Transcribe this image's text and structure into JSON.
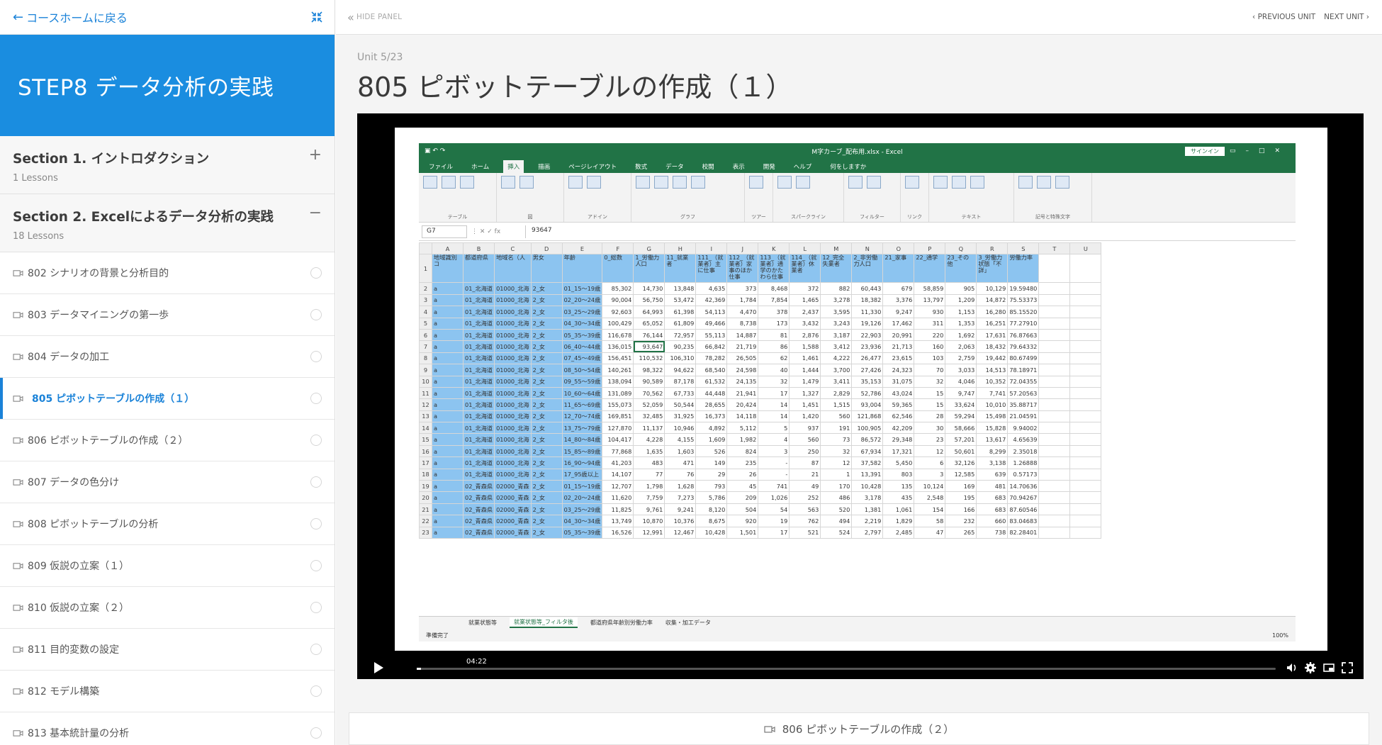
{
  "sidebar": {
    "back_label": "コースホームに戻る",
    "course_title": "STEP8 データ分析の実践",
    "sections": [
      {
        "title": "Section 1. イントロダクション",
        "count": "1 Lessons",
        "toggle": "+"
      },
      {
        "title": "Section 2. Excelによるデータ分析の実践",
        "count": "18 Lessons",
        "toggle": "−"
      }
    ],
    "lessons": [
      {
        "label": "802 シナリオの背景と分析目的"
      },
      {
        "label": "803 データマイニングの第一歩"
      },
      {
        "label": "804 データの加工"
      },
      {
        "label": "805 ピボットテーブルの作成（１）"
      },
      {
        "label": "806 ピボットテーブルの作成（２）"
      },
      {
        "label": "807 データの色分け"
      },
      {
        "label": "808 ピボットテーブルの分析"
      },
      {
        "label": "809 仮説の立案（１）"
      },
      {
        "label": "810 仮説の立案（２）"
      },
      {
        "label": "811 目的変数の設定"
      },
      {
        "label": "812 モデル構築"
      },
      {
        "label": "813 基本統計量の分析"
      }
    ],
    "active_lesson": 3
  },
  "topbar": {
    "hide_panel": "HIDE PANEL",
    "prev_unit": "PREVIOUS UNIT",
    "next_unit": "NEXT UNIT"
  },
  "unit": {
    "number": "Unit 5/23",
    "title": "805 ピボットテーブルの作成（１）"
  },
  "video": {
    "timecode": "04:22",
    "progress_fraction": 0.005
  },
  "excel": {
    "filename": "M字カーブ_配布用.xlsx - Excel",
    "signin": "サインイン",
    "tabs": [
      "ファイル",
      "ホーム",
      "挿入",
      "描画",
      "ページレイアウト",
      "数式",
      "データ",
      "校閲",
      "表示",
      "開発",
      "ヘルプ",
      "何をしますか"
    ],
    "active_tab": "挿入",
    "ribbon_groups": [
      "テーブル",
      "図",
      "アドイン",
      "グラフ",
      "ツアー",
      "スパークライン",
      "フィルター",
      "リンク",
      "テキスト",
      "記号と特殊文字"
    ],
    "name_box": "G7",
    "formula_value": "93647",
    "col_letters": [
      "A",
      "B",
      "C",
      "D",
      "E",
      "F",
      "G",
      "H",
      "I",
      "J",
      "K",
      "L",
      "M",
      "N",
      "O",
      "P",
      "Q",
      "R",
      "S",
      "T",
      "U"
    ],
    "header_row": [
      "地域識別コ",
      "都道府県",
      "地域名（人",
      "男女",
      "年齢",
      "0_総数",
      "1_労働力人口",
      "11_就業者",
      "111_（就業者）主に仕事",
      "112_（就業者）家事のほか仕事",
      "113_（就業者）通学のかたわら仕事",
      "114_（就業者）休業者",
      "12_完全失業者",
      "2_非労働力人口",
      "21_家事",
      "22_通学",
      "23_その他",
      "3_労働力状態「不詳」",
      "労働力率",
      "",
      ""
    ],
    "rows": [
      [
        "a",
        "01_北海道",
        "01000_北海",
        "2_女",
        "01_15～19歳",
        "85,302",
        "14,730",
        "13,848",
        "4,635",
        "373",
        "8,468",
        "372",
        "882",
        "60,443",
        "679",
        "58,859",
        "905",
        "10,129",
        "19.59480"
      ],
      [
        "a",
        "01_北海道",
        "01000_北海",
        "2_女",
        "02_20～24歳",
        "90,004",
        "56,750",
        "53,472",
        "42,369",
        "1,784",
        "7,854",
        "1,465",
        "3,278",
        "18,382",
        "3,376",
        "13,797",
        "1,209",
        "14,872",
        "75.53373"
      ],
      [
        "a",
        "01_北海道",
        "01000_北海",
        "2_女",
        "03_25～29歳",
        "92,603",
        "64,993",
        "61,398",
        "54,113",
        "4,470",
        "378",
        "2,437",
        "3,595",
        "11,330",
        "9,247",
        "930",
        "1,153",
        "16,280",
        "85.15520"
      ],
      [
        "a",
        "01_北海道",
        "01000_北海",
        "2_女",
        "04_30～34歳",
        "100,429",
        "65,052",
        "61,809",
        "49,466",
        "8,738",
        "173",
        "3,432",
        "3,243",
        "19,126",
        "17,462",
        "311",
        "1,353",
        "16,251",
        "77.27910"
      ],
      [
        "a",
        "01_北海道",
        "01000_北海",
        "2_女",
        "05_35～39歳",
        "116,678",
        "76,144",
        "72,957",
        "55,113",
        "14,887",
        "81",
        "2,876",
        "3,187",
        "22,903",
        "20,991",
        "220",
        "1,692",
        "17,631",
        "76.87663"
      ],
      [
        "a",
        "01_北海道",
        "01000_北海",
        "2_女",
        "06_40～44歳",
        "136,015",
        "93,647",
        "90,235",
        "66,842",
        "21,719",
        "86",
        "1,588",
        "3,412",
        "23,936",
        "21,713",
        "160",
        "2,063",
        "18,432",
        "79.64332"
      ],
      [
        "a",
        "01_北海道",
        "01000_北海",
        "2_女",
        "07_45～49歳",
        "156,451",
        "110,532",
        "106,310",
        "78,282",
        "26,505",
        "62",
        "1,461",
        "4,222",
        "26,477",
        "23,615",
        "103",
        "2,759",
        "19,442",
        "80.67499"
      ],
      [
        "a",
        "01_北海道",
        "01000_北海",
        "2_女",
        "08_50～54歳",
        "140,261",
        "98,322",
        "94,622",
        "68,540",
        "24,598",
        "40",
        "1,444",
        "3,700",
        "27,426",
        "24,323",
        "70",
        "3,033",
        "14,513",
        "78.18971"
      ],
      [
        "a",
        "01_北海道",
        "01000_北海",
        "2_女",
        "09_55～59歳",
        "138,094",
        "90,589",
        "87,178",
        "61,532",
        "24,135",
        "32",
        "1,479",
        "3,411",
        "35,153",
        "31,075",
        "32",
        "4,046",
        "10,352",
        "72.04355"
      ],
      [
        "a",
        "01_北海道",
        "01000_北海",
        "2_女",
        "10_60～64歳",
        "131,089",
        "70,562",
        "67,733",
        "44,448",
        "21,941",
        "17",
        "1,327",
        "2,829",
        "52,786",
        "43,024",
        "15",
        "9,747",
        "7,741",
        "57.20563"
      ],
      [
        "a",
        "01_北海道",
        "01000_北海",
        "2_女",
        "11_65～69歳",
        "155,073",
        "52,059",
        "50,544",
        "28,655",
        "20,424",
        "14",
        "1,451",
        "1,515",
        "93,004",
        "59,365",
        "15",
        "33,624",
        "10,010",
        "35.88717"
      ],
      [
        "a",
        "01_北海道",
        "01000_北海",
        "2_女",
        "12_70～74歳",
        "169,851",
        "32,485",
        "31,925",
        "16,373",
        "14,118",
        "14",
        "1,420",
        "560",
        "121,868",
        "62,546",
        "28",
        "59,294",
        "15,498",
        "21.04591"
      ],
      [
        "a",
        "01_北海道",
        "01000_北海",
        "2_女",
        "13_75～79歳",
        "127,870",
        "11,137",
        "10,946",
        "4,892",
        "5,112",
        "5",
        "937",
        "191",
        "100,905",
        "42,209",
        "30",
        "58,666",
        "15,828",
        "9.94002"
      ],
      [
        "a",
        "01_北海道",
        "01000_北海",
        "2_女",
        "14_80～84歳",
        "104,417",
        "4,228",
        "4,155",
        "1,609",
        "1,982",
        "4",
        "560",
        "73",
        "86,572",
        "29,348",
        "23",
        "57,201",
        "13,617",
        "4.65639"
      ],
      [
        "a",
        "01_北海道",
        "01000_北海",
        "2_女",
        "15_85～89歳",
        "77,868",
        "1,635",
        "1,603",
        "526",
        "824",
        "3",
        "250",
        "32",
        "67,934",
        "17,321",
        "12",
        "50,601",
        "8,299",
        "2.35018"
      ],
      [
        "a",
        "01_北海道",
        "01000_北海",
        "2_女",
        "16_90～94歳",
        "41,203",
        "483",
        "471",
        "149",
        "235",
        "-",
        "87",
        "12",
        "37,582",
        "5,450",
        "6",
        "32,126",
        "3,138",
        "1.26888"
      ],
      [
        "a",
        "01_北海道",
        "01000_北海",
        "2_女",
        "17_95歳以上",
        "14,107",
        "77",
        "76",
        "29",
        "26",
        "-",
        "21",
        "1",
        "13,391",
        "803",
        "3",
        "12,585",
        "639",
        "0.57173"
      ],
      [
        "a",
        "02_青森県",
        "02000_青森",
        "2_女",
        "01_15～19歳",
        "12,707",
        "1,798",
        "1,628",
        "793",
        "45",
        "741",
        "49",
        "170",
        "10,428",
        "135",
        "10,124",
        "169",
        "481",
        "14.70636"
      ],
      [
        "a",
        "02_青森県",
        "02000_青森",
        "2_女",
        "02_20～24歳",
        "11,620",
        "7,759",
        "7,273",
        "5,786",
        "209",
        "1,026",
        "252",
        "486",
        "3,178",
        "435",
        "2,548",
        "195",
        "683",
        "70.94267"
      ],
      [
        "a",
        "02_青森県",
        "02000_青森",
        "2_女",
        "03_25～29歳",
        "11,825",
        "9,761",
        "9,241",
        "8,120",
        "504",
        "54",
        "563",
        "520",
        "1,381",
        "1,061",
        "154",
        "166",
        "683",
        "87.60546"
      ],
      [
        "a",
        "02_青森県",
        "02000_青森",
        "2_女",
        "04_30～34歳",
        "13,749",
        "10,870",
        "10,376",
        "8,675",
        "920",
        "19",
        "762",
        "494",
        "2,219",
        "1,829",
        "58",
        "232",
        "660",
        "83.04683"
      ],
      [
        "a",
        "02_青森県",
        "02000_青森",
        "2_女",
        "05_35～39歳",
        "16,526",
        "12,991",
        "12,467",
        "10,428",
        "1,501",
        "17",
        "521",
        "524",
        "2,797",
        "2,485",
        "47",
        "265",
        "738",
        "82.28401"
      ]
    ],
    "sheet_tabs": [
      "就業状態等",
      "就業状態等_フィルタ後",
      "都道府県年齢別労働力率",
      "収集・加工データ"
    ],
    "active_sheet": "就業状態等_フィルタ後",
    "status_left": "準備完了",
    "zoom": "100%"
  },
  "next_bar": {
    "label": "806 ピボットテーブルの作成（２）"
  },
  "colors": {
    "accent": "#1a8de0",
    "excel_green": "#217346",
    "header_fill": "#8cc4f0"
  }
}
